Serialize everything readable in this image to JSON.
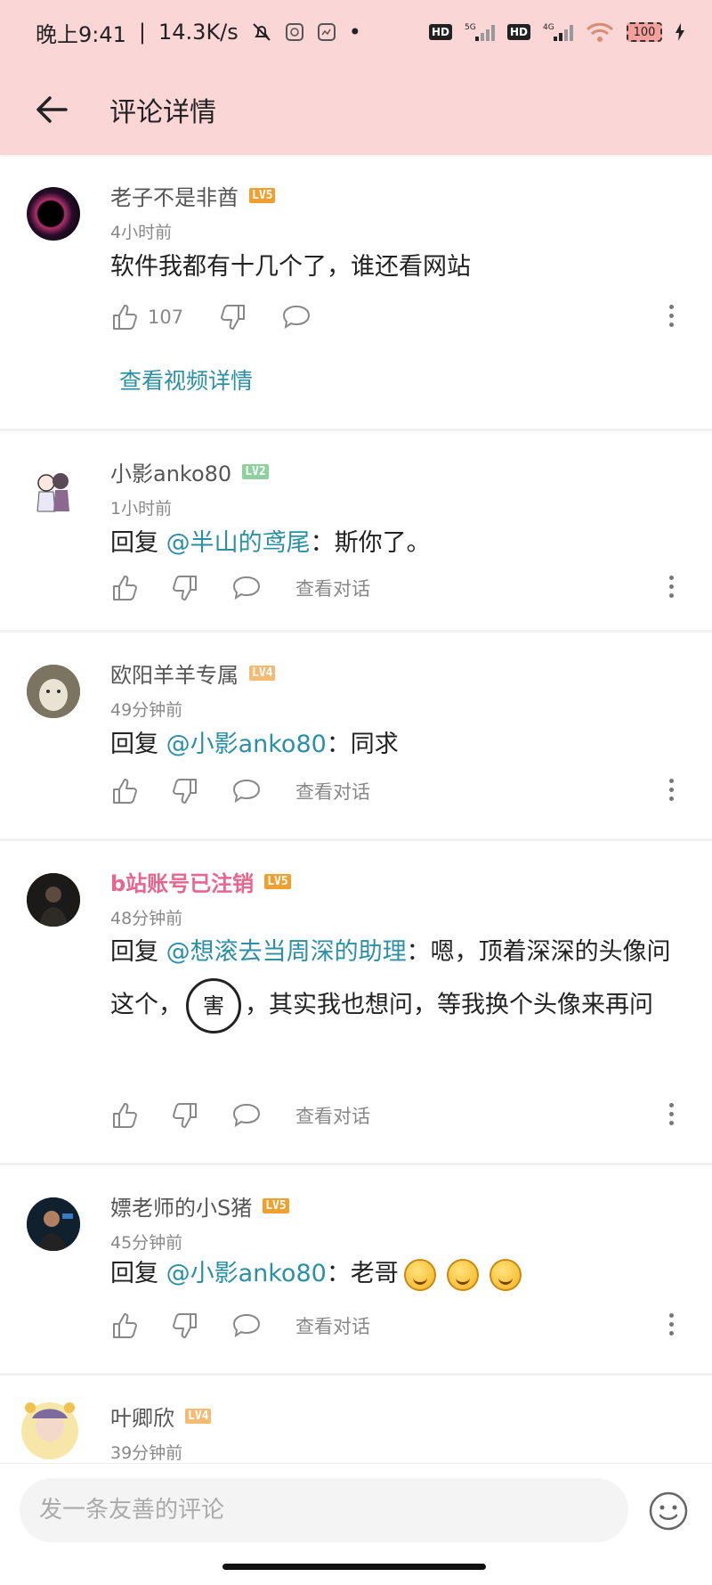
{
  "status_bar": {
    "time": "晚上9:41",
    "net_speed": "14.3K/s",
    "hd1": "HD",
    "net1": "5G",
    "hd2": "HD",
    "net2": "4G",
    "battery": "100"
  },
  "header": {
    "title": "评论详情"
  },
  "comments": [
    {
      "user": "老子不是非酋",
      "level": "LV5",
      "level_color": "#f0a030",
      "time": "4小时前",
      "text": "软件我都有十几个了，谁还看网站",
      "likes": "107",
      "link": "查看视频详情"
    },
    {
      "user": "小影anko80",
      "level": "LV2",
      "level_color": "#8fd19e",
      "time": "1小时前",
      "reply_prefix": "回复 ",
      "mention": "@半山的鸢尾",
      "text": "：斯你了。",
      "view_conv": "查看对话"
    },
    {
      "user": "欧阳羊羊专属",
      "level": "LV4",
      "level_color": "#f3bb73",
      "time": "49分钟前",
      "reply_prefix": "回复 ",
      "mention": "@小影anko80",
      "text": "：同求",
      "view_conv": "查看对话"
    },
    {
      "user": "b站账号已注销",
      "level": "LV5",
      "level_color": "#f0a030",
      "time": "48分钟前",
      "reply_prefix": "回复 ",
      "mention": "@想滚去当周深的助理",
      "text_a": "：嗯，顶着深深的头像问这个，",
      "sticker": "害",
      "text_b": "，其实我也想问，等我换个头像来再问",
      "view_conv": "查看对话"
    },
    {
      "user": "嫖老师的小S猪",
      "level": "LV5",
      "level_color": "#f0a030",
      "time": "45分钟前",
      "reply_prefix": "回复 ",
      "mention": "@小影anko80",
      "text": "：老哥",
      "view_conv": "查看对话"
    },
    {
      "user": "叶卿欣",
      "level": "LV4",
      "level_color": "#f3bb73",
      "time": "39分钟前"
    }
  ],
  "bottom": {
    "placeholder": "发一条友善的评论"
  },
  "colors": {
    "header_bg": "#fbd6d6",
    "link": "#2b8fa6",
    "vip_name": "#e8668d"
  }
}
